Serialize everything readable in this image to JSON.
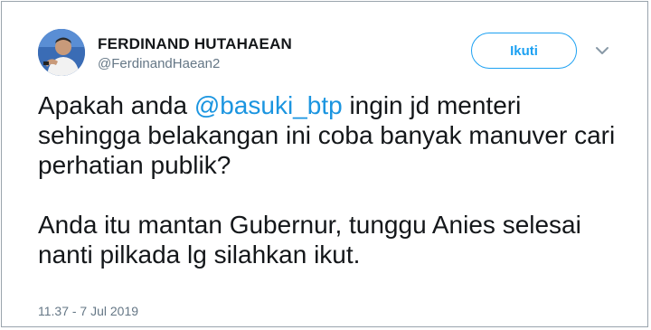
{
  "author": {
    "name": "FERDINAND HUTAHAEAN",
    "handle": "@FerdinandHaean2",
    "avatar_icon": "profile-photo"
  },
  "actions": {
    "follow_label": "Ikuti",
    "menu_icon": "chevron-down-icon"
  },
  "tweet": {
    "line1_before": "Apakah anda ",
    "mention": "@basuki_btp",
    "line1_after": " ingin jd menteri sehingga belakangan ini coba banyak manuver cari perhatian publik?",
    "paragraph2": "Anda itu mantan Gubernur, tunggu Anies selesai nanti pilkada lg silahkan ikut."
  },
  "timestamp": "11.37 - 7 Jul 2019",
  "colors": {
    "accent": "#1da1f2",
    "mention": "#1b95e0",
    "text": "#14171a",
    "muted": "#657786"
  }
}
